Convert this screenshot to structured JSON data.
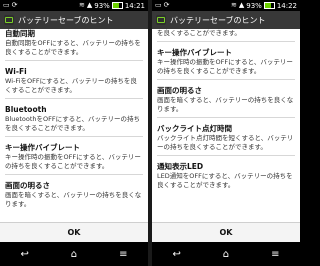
{
  "status_bar": {
    "left": {
      "battery_percent": "93%",
      "time": "14:21"
    },
    "right": {
      "battery_percent": "93%",
      "time": "14:22"
    }
  },
  "dialog": {
    "title": "バッテリーセーブのヒント",
    "ok_label": "OK"
  },
  "left_panel": {
    "items": [
      {
        "title": "自動同期",
        "desc": "自動同期をOFFにすると、バッテリーの持ちを良くすることができます。"
      },
      {
        "title": "Wi-Fi",
        "desc": "Wi-FiをOFFにすると、バッテリーの持ちを良くすることができます。"
      },
      {
        "title": "Bluetooth",
        "desc": "BluetoothをOFFにすると、バッテリーの持ちを良くすることができます。"
      },
      {
        "title": "キー操作バイブレート",
        "desc": "キー操作時の振動をOFFにすると、バッテリーの持ちを良くすることができます。"
      },
      {
        "title": "画面の明るさ",
        "desc": "画面を暗くすると、バッテリーの持ちを良くなります。"
      }
    ]
  },
  "right_panel": {
    "partial_top": "を良くすることができます。",
    "items": [
      {
        "title": "キー操作バイブレート",
        "desc": "キー操作時の振動をOFFにすると、バッテリーの持ちを良くすることができます。"
      },
      {
        "title": "画面の明るさ",
        "desc": "画面を暗くすると、バッテリーの持ちを良くなります。"
      },
      {
        "title": "バックライト点灯時間",
        "desc": "バックライト点灯時間を短くすると、バッテリーの持ちを良くすることができます。"
      },
      {
        "title": "通知表示LED",
        "desc": "LED通知をOFFにすると、バッテリーの持ちを良くすることができます。"
      }
    ]
  },
  "nav": {
    "back_icon": "back-icon",
    "home_icon": "home-icon",
    "menu_icon": "menu-icon"
  }
}
